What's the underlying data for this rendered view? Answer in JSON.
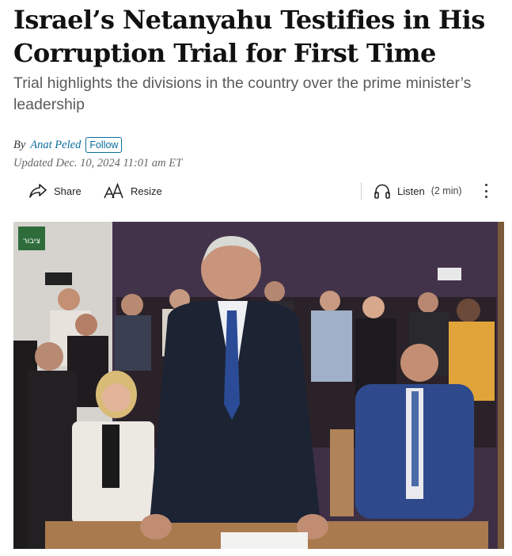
{
  "article": {
    "headline": "Israel’s Netanyahu Testifies in His Corruption Trial for First Time",
    "dek": "Trial highlights the divisions in the country over the prime minister’s leadership",
    "byline": {
      "prefix": "By",
      "author": "Anat Peled",
      "follow_label": "Follow"
    },
    "updated": "Updated Dec. 10, 2024 11:01 am ET"
  },
  "toolbar": {
    "share_label": "Share",
    "resize_label": "Resize",
    "listen_label": "Listen",
    "listen_duration": "(2 min)"
  },
  "photo": {
    "sign_text": "ציבור"
  },
  "colors": {
    "link": "#0a6e9e",
    "dek_gray": "#5a5a5a",
    "wall_purple": "#3e2f45"
  }
}
